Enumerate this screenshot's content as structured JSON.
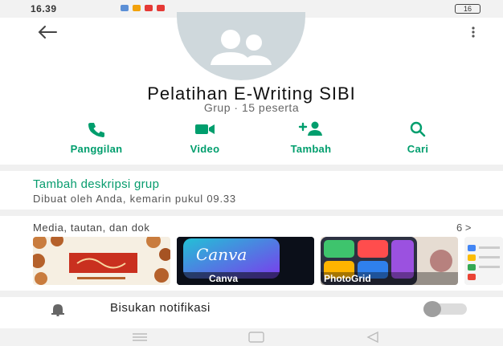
{
  "status_bar": {
    "time": "16.39",
    "battery": "16"
  },
  "header": {
    "back_icon": "arrow-left-icon",
    "menu_icon": "more-vertical-icon"
  },
  "group": {
    "name": "Pelatihan E-Writing SIBI",
    "subtitle": "Grup · 15 peserta"
  },
  "actions": [
    {
      "label": "Panggilan",
      "icon": "phone-icon"
    },
    {
      "label": "Video",
      "icon": "video-icon"
    },
    {
      "label": "Tambah",
      "icon": "add-person-icon"
    },
    {
      "label": "Cari",
      "icon": "search-icon"
    }
  ],
  "description": {
    "add_label": "Tambah deskripsi grup",
    "created": "Dibuat oleh Anda, kemarin pukul 09.33"
  },
  "media": {
    "title": "Media, tautan, dan dok",
    "count": "6 >",
    "thumbs": [
      {
        "name": "poster"
      },
      {
        "name": "canva",
        "logo": "Canva",
        "caption": "Canva"
      },
      {
        "name": "photogrid",
        "caption": "PhotoGrid"
      },
      {
        "name": "partial"
      }
    ]
  },
  "notifications": {
    "label": "Bisukan notifikasi",
    "enabled": false
  },
  "colors": {
    "accent": "#009e6d",
    "avatar_bg": "#cfd8dc"
  }
}
